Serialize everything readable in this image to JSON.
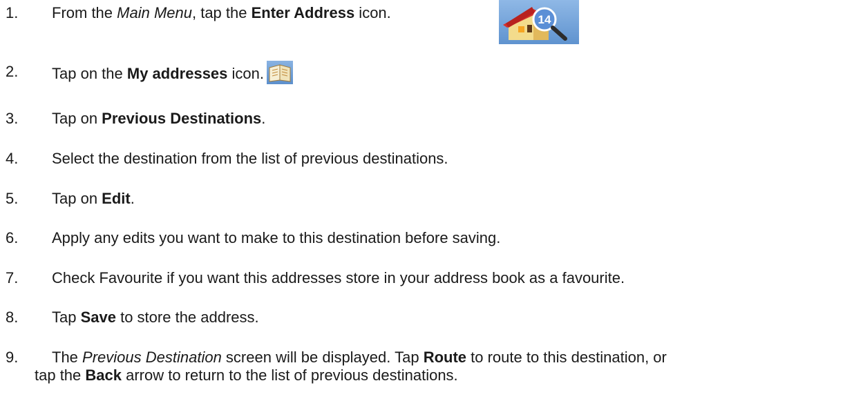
{
  "steps": [
    {
      "num": "1.",
      "parts": [
        "From the ",
        "Main Menu",
        ", tap the ",
        "Enter Address",
        " icon."
      ],
      "icon": "enter-address-icon"
    },
    {
      "num": "2.",
      "parts": [
        "Tap on the ",
        "My addresses",
        " icon."
      ],
      "icon": "my-addresses-icon"
    },
    {
      "num": "3.",
      "parts": [
        "Tap on ",
        "Previous Destinations",
        "."
      ]
    },
    {
      "num": "4.",
      "parts": [
        "Select the destination from the list of previous destinations."
      ]
    },
    {
      "num": "5.",
      "parts": [
        "Tap on ",
        "Edit",
        "."
      ]
    },
    {
      "num": "6.",
      "parts": [
        "Apply any edits you want to make to this destination before saving."
      ]
    },
    {
      "num": "7.",
      "parts": [
        "Check Favourite if you want this addresses store in your address book as a favourite."
      ]
    },
    {
      "num": "8.",
      "parts": [
        "Tap ",
        "Save",
        " to store the address."
      ]
    },
    {
      "num": "9.",
      "parts": [
        "The ",
        "Previous Destination",
        " screen will be displayed.  Tap ",
        "Route",
        " to route to this destination, or",
        "tap the ",
        "Back",
        " arrow to return to the list of previous destinations."
      ]
    }
  ],
  "colors": {
    "text": "#1a1a1a",
    "icon_blue_light": "#8fb8e6",
    "icon_blue_dark": "#5f93cf",
    "house_roof": "#d6312b",
    "house_wall": "#f1d27a",
    "badge": "#5b8fd6"
  }
}
